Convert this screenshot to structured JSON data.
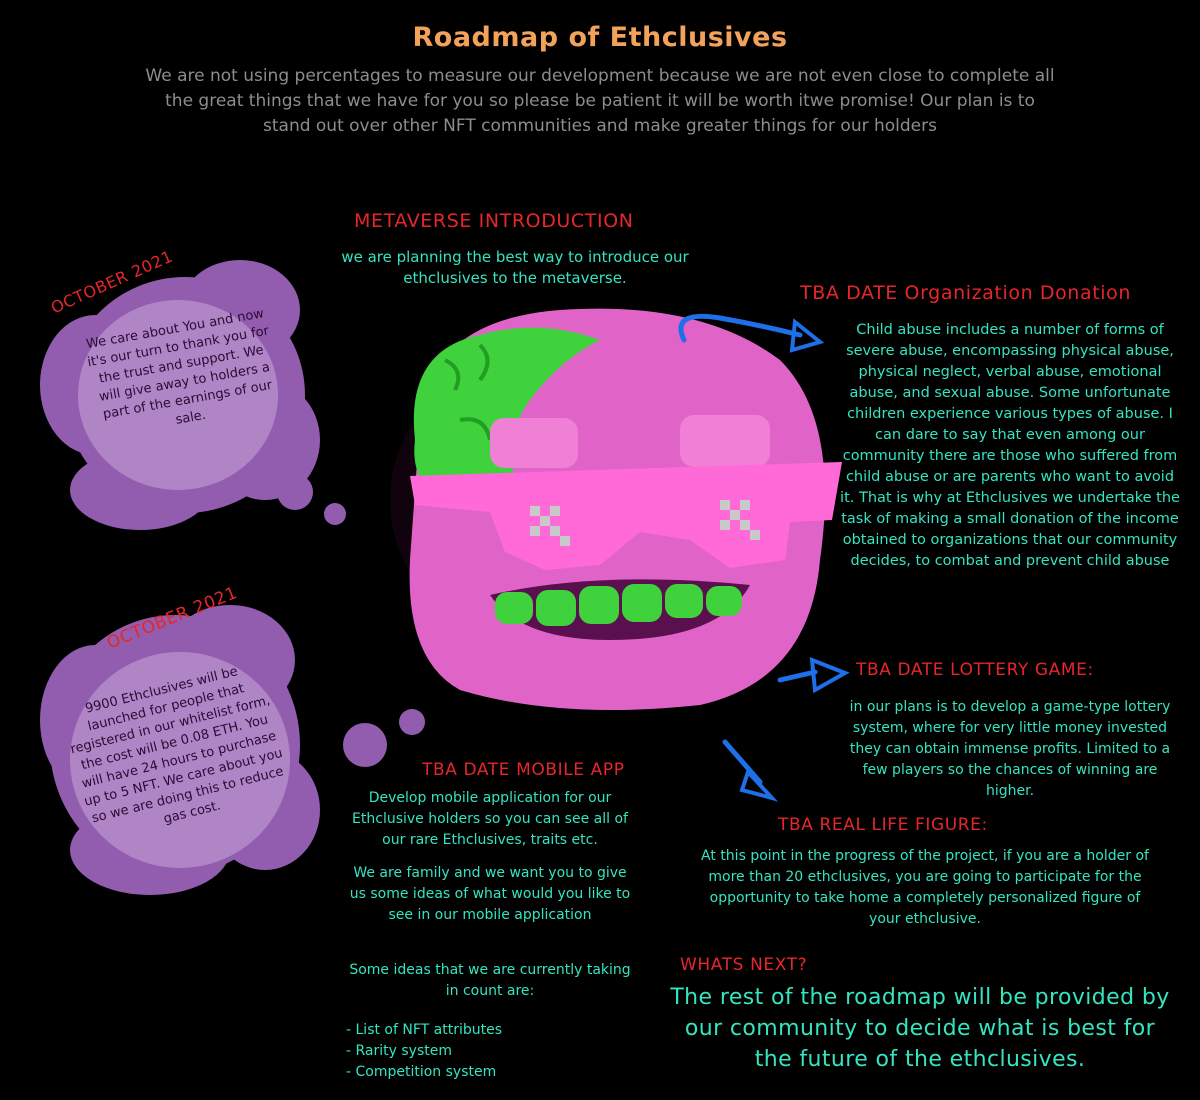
{
  "title": "Roadmap of Ethclusives",
  "intro": "We are not using percentages to measure our development because we are not even close to complete all the great things that we have for you so please be patient it will be worth itwe promise! Our plan is to stand out over other NFT communities and make greater things for our holders",
  "metaverse": {
    "heading": "METAVERSE INTRODUCTION",
    "text": "we are planning the best way to introduce our ethclusives to the metaverse."
  },
  "donation": {
    "heading": "TBA DATE Organization Donation",
    "text": "Child abuse includes a number of forms of severe abuse, encompassing physical abuse, physical neglect, verbal abuse, emotional abuse, and sexual abuse. Some unfortunate children experience various types of abuse. I can dare to say that even among our community there are those who suffered from child abuse or are parents who want to avoid it. That is why at Ethclusives we undertake the task of making a small donation of the income obtained to organizations that our community decides, to combat and prevent child abuse"
  },
  "october_1": {
    "label": "OCTOBER 2021",
    "text": "We care about You and now it's our turn to thank you for the trust and support. We will give away to holders a part of the earnings of our sale."
  },
  "october_2": {
    "label": "OCTOBER 2021",
    "text": "9900 Ethclusives will be launched for people that registered in our whitelist form, the cost will be 0.08 ETH. You will have 24 hours to purchase up to 5 NFT. We care about you so we are doing this to reduce gas cost."
  },
  "lottery": {
    "heading": "TBA DATE LOTTERY GAME:",
    "text": "in our plans is to develop a game-type lottery system, where for very little money invested they can obtain immense profits. Limited to a few players so the chances of winning are higher."
  },
  "mobile": {
    "heading": "TBA DATE MOBILE APP",
    "para1": "Develop mobile application for our Ethclusive holders so you can see all of our rare Ethclusives, traits etc.",
    "para2": "We are family and we want you to give us some ideas of what would you like to see in our mobile application",
    "para3": "Some ideas that we are currently taking in count are:",
    "list": [
      "-  List of NFT attributes",
      "- Rarity system",
      "- Competition system"
    ]
  },
  "figure": {
    "heading": "TBA REAL LIFE FIGURE:",
    "text": "At this point in the progress of the project, if you are a holder of more than 20 ethclusives, you are going to participate for the opportunity to take home a completely personalized figure of your ethclusive."
  },
  "next": {
    "heading": "WHATS NEXT?",
    "text": "The rest of the roadmap will be provided by our community to decide what is best for the future of the ethclusives."
  },
  "colors": {
    "background": "#000000",
    "title": "#f2a25a",
    "heading": "#e6262a",
    "text": "#35e4c0",
    "bubble": "#9a63b8",
    "arrow": "#1f6fe8",
    "character": "#e064c8",
    "brain": "#3fd23c",
    "glasses": "#ff6ad8"
  },
  "icons": [
    "arrow-icon",
    "thought-bubble",
    "character-illustration"
  ]
}
